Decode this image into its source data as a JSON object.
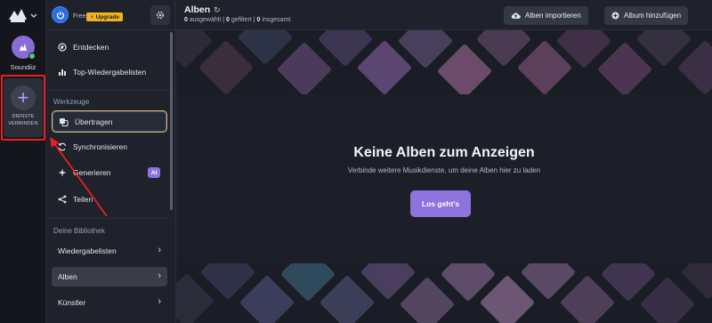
{
  "rail": {
    "service_name": "Soundiiz",
    "connect_line1": "DIENSTE",
    "connect_line2": "VERBINDEN"
  },
  "account": {
    "plan": "Free",
    "upgrade_label": "Upgrade"
  },
  "nav": {
    "discover": "Entdecken",
    "top_playlists": "Top-Wiedergabelisten"
  },
  "tools": {
    "section_label": "Werkzeuge",
    "transfer": "Übertragen",
    "sync": "Synchronisieren",
    "generate": "Generieren",
    "generate_badge": "AI",
    "share": "Teilen"
  },
  "library": {
    "section_label": "Deine Bibliothek",
    "items": [
      {
        "label": "Wiedergabelisten"
      },
      {
        "label": "Alben"
      },
      {
        "label": "Künstler"
      }
    ]
  },
  "header": {
    "title": "Alben",
    "selected_count": "0",
    "selected_label": "ausgewählt",
    "filtered_count": "0",
    "filtered_label": "gefiltert",
    "total_count": "0",
    "total_label": "insgesamt",
    "import_button": "Alben importieren",
    "add_button": "Album hinzufügen"
  },
  "empty_state": {
    "title": "Keine Alben zum Anzeigen",
    "subtitle": "Verbinde weitere Musikdienste, um deine Alben hier zu laden",
    "cta": "Los geht's"
  },
  "colors": {
    "accent": "#8c73dd",
    "highlight": "#e8201f",
    "upgrade": "#f1b420"
  }
}
